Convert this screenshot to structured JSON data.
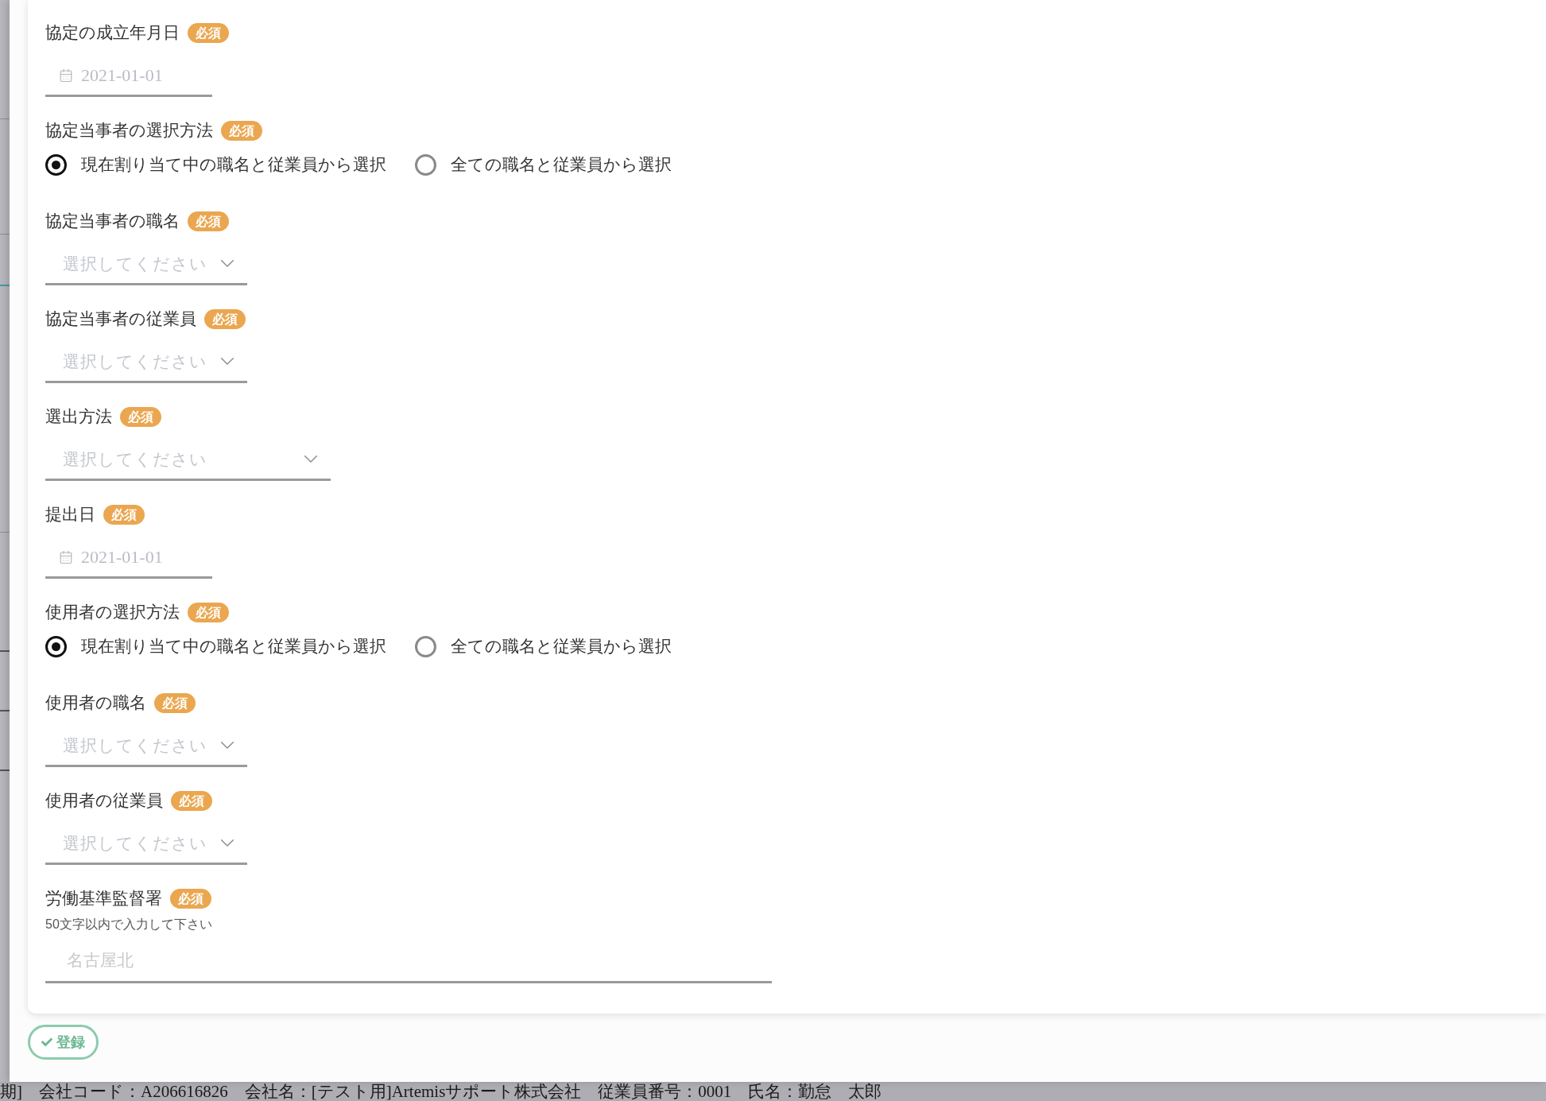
{
  "fields": [
    {
      "kind": "date",
      "label": "協定の成立年月日",
      "badge": "必須",
      "placeholder": "2021-01-01"
    },
    {
      "kind": "radio",
      "label": "協定当事者の選択方法",
      "badge": "必須",
      "options": [
        {
          "label": "現在割り当て中の職名と従業員から選択",
          "selected": true
        },
        {
          "label": "全ての職名と従業員から選択",
          "selected": false
        }
      ]
    },
    {
      "kind": "select",
      "label": "協定当事者の職名",
      "badge": "必須",
      "placeholder": "選択してください"
    },
    {
      "kind": "select",
      "label": "協定当事者の従業員",
      "badge": "必須",
      "placeholder": "選択してください"
    },
    {
      "kind": "select",
      "label": "選出方法",
      "badge": "必須",
      "placeholder": "選択してください"
    },
    {
      "kind": "date",
      "label": "提出日",
      "badge": "必須",
      "placeholder": "2021-01-01"
    },
    {
      "kind": "radio",
      "label": "使用者の選択方法",
      "badge": "必須",
      "options": [
        {
          "label": "現在割り当て中の職名と従業員から選択",
          "selected": true
        },
        {
          "label": "全ての職名と従業員から選択",
          "selected": false
        }
      ]
    },
    {
      "kind": "select",
      "label": "使用者の職名",
      "badge": "必須",
      "placeholder": "選択してください"
    },
    {
      "kind": "select",
      "label": "使用者の従業員",
      "badge": "必須",
      "placeholder": "選択してください"
    },
    {
      "kind": "text",
      "label": "労働基準監督署",
      "badge": "必須",
      "hint": "50文字以内で入力して下さい",
      "placeholder": "名古屋北"
    }
  ],
  "submit_button": {
    "label": "登録"
  },
  "footer": {
    "text": "期]　会社コード：A206616826　会社名：[テスト用]Artemisサポート株式会社　従業員番号：0001　氏名：勤怠　太郎"
  }
}
